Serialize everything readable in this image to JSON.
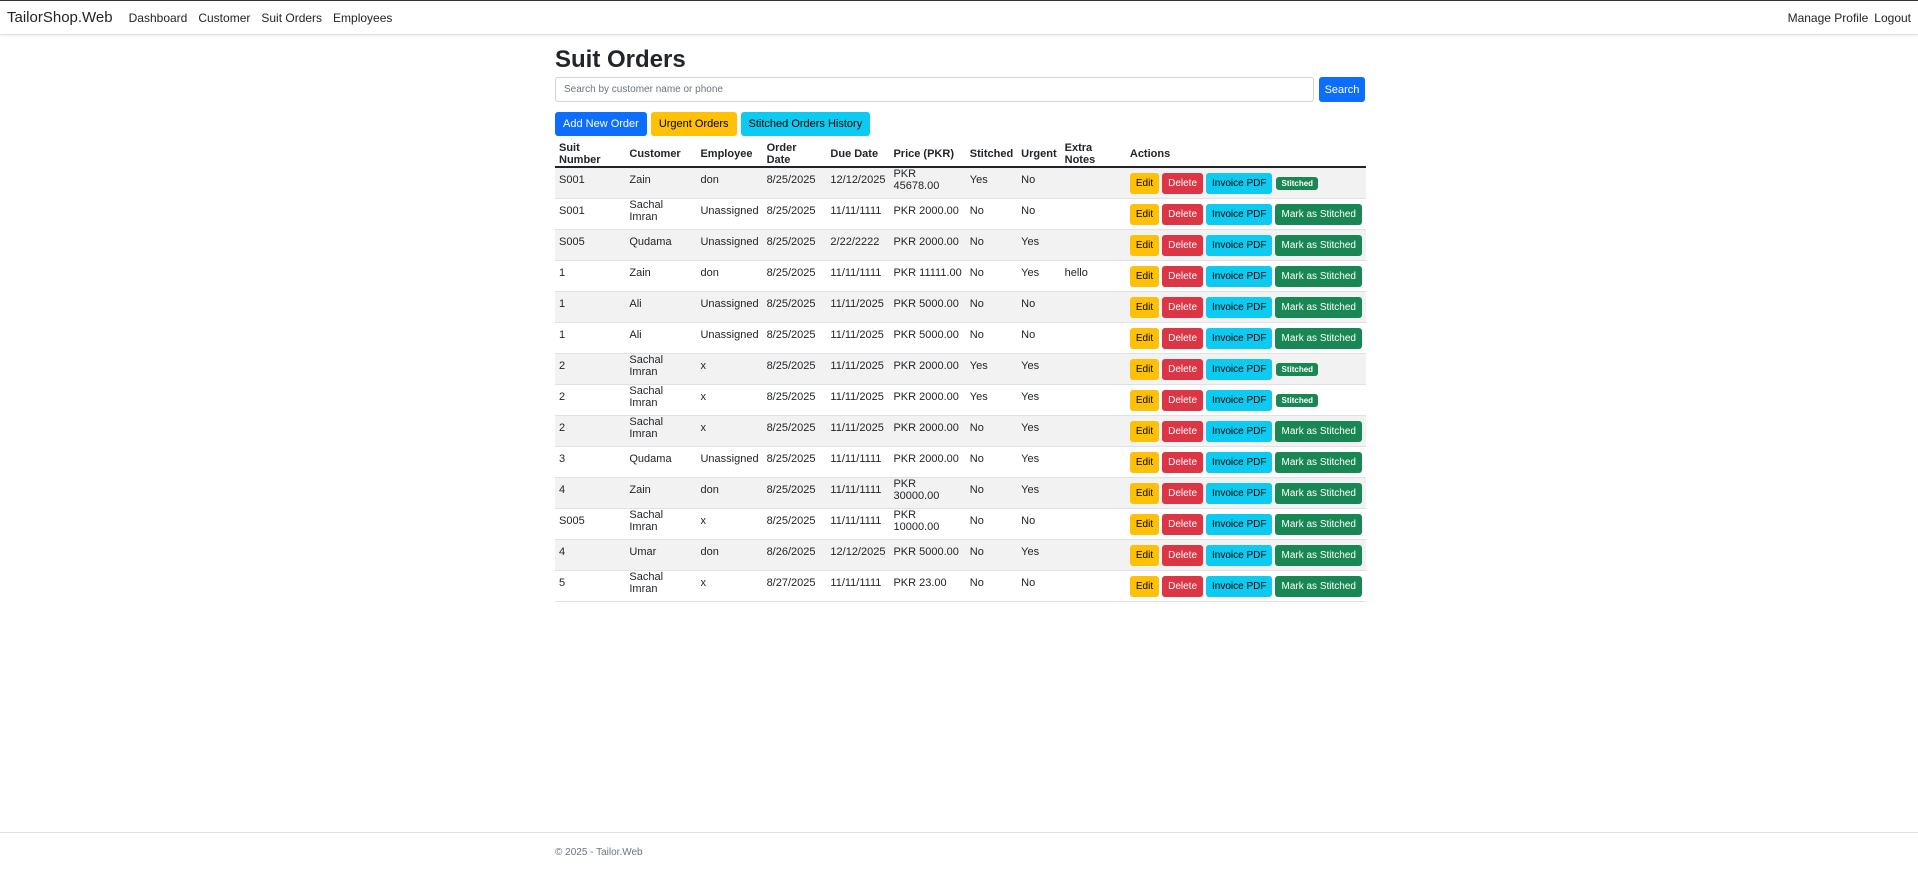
{
  "nav": {
    "brand": "TailorShop.Web",
    "links": [
      "Dashboard",
      "Customer",
      "Suit Orders",
      "Employees"
    ],
    "right": [
      "Manage Profile",
      "Logout"
    ]
  },
  "page": {
    "title": "Suit Orders"
  },
  "search": {
    "placeholder": "Search by customer name or phone",
    "value": "",
    "button": "Search"
  },
  "actions": {
    "add": "Add New Order",
    "urgent": "Urgent Orders",
    "history": "Stitched Orders History"
  },
  "table": {
    "headers": [
      "Suit Number",
      "Customer",
      "Employee",
      "Order Date",
      "Due Date",
      "Price (PKR)",
      "Stitched",
      "Urgent",
      "Extra Notes",
      "Actions"
    ],
    "rows": [
      {
        "suit": "S001",
        "customer": "Zain",
        "employee": "don",
        "order_date": "8/25/2025",
        "due_date": "12/12/2025",
        "price": "PKR 45678.00",
        "stitched": "Yes",
        "urgent": "No",
        "notes": "",
        "is_stitched": true
      },
      {
        "suit": "S001",
        "customer": "Sachal Imran",
        "employee": "Unassigned",
        "order_date": "8/25/2025",
        "due_date": "11/11/1111",
        "price": "PKR 2000.00",
        "stitched": "No",
        "urgent": "No",
        "notes": "",
        "is_stitched": false
      },
      {
        "suit": "S005",
        "customer": "Qudama",
        "employee": "Unassigned",
        "order_date": "8/25/2025",
        "due_date": "2/22/2222",
        "price": "PKR 2000.00",
        "stitched": "No",
        "urgent": "Yes",
        "notes": "",
        "is_stitched": false
      },
      {
        "suit": "1",
        "customer": "Zain",
        "employee": "don",
        "order_date": "8/25/2025",
        "due_date": "11/11/1111",
        "price": "PKR 11111.00",
        "stitched": "No",
        "urgent": "Yes",
        "notes": "hello",
        "is_stitched": false
      },
      {
        "suit": "1",
        "customer": "Ali",
        "employee": "Unassigned",
        "order_date": "8/25/2025",
        "due_date": "11/11/2025",
        "price": "PKR 5000.00",
        "stitched": "No",
        "urgent": "No",
        "notes": "",
        "is_stitched": false
      },
      {
        "suit": "1",
        "customer": "Ali",
        "employee": "Unassigned",
        "order_date": "8/25/2025",
        "due_date": "11/11/2025",
        "price": "PKR 5000.00",
        "stitched": "No",
        "urgent": "No",
        "notes": "",
        "is_stitched": false
      },
      {
        "suit": "2",
        "customer": "Sachal Imran",
        "employee": "x",
        "order_date": "8/25/2025",
        "due_date": "11/11/2025",
        "price": "PKR 2000.00",
        "stitched": "Yes",
        "urgent": "Yes",
        "notes": "",
        "is_stitched": true
      },
      {
        "suit": "2",
        "customer": "Sachal Imran",
        "employee": "x",
        "order_date": "8/25/2025",
        "due_date": "11/11/2025",
        "price": "PKR 2000.00",
        "stitched": "Yes",
        "urgent": "Yes",
        "notes": "",
        "is_stitched": true
      },
      {
        "suit": "2",
        "customer": "Sachal Imran",
        "employee": "x",
        "order_date": "8/25/2025",
        "due_date": "11/11/2025",
        "price": "PKR 2000.00",
        "stitched": "No",
        "urgent": "Yes",
        "notes": "",
        "is_stitched": false
      },
      {
        "suit": "3",
        "customer": "Qudama",
        "employee": "Unassigned",
        "order_date": "8/25/2025",
        "due_date": "11/11/1111",
        "price": "PKR 2000.00",
        "stitched": "No",
        "urgent": "Yes",
        "notes": "",
        "is_stitched": false
      },
      {
        "suit": "4",
        "customer": "Zain",
        "employee": "don",
        "order_date": "8/25/2025",
        "due_date": "11/11/1111",
        "price": "PKR 30000.00",
        "stitched": "No",
        "urgent": "Yes",
        "notes": "",
        "is_stitched": false
      },
      {
        "suit": "S005",
        "customer": "Sachal Imran",
        "employee": "x",
        "order_date": "8/25/2025",
        "due_date": "11/11/1111",
        "price": "PKR 10000.00",
        "stitched": "No",
        "urgent": "No",
        "notes": "",
        "is_stitched": false
      },
      {
        "suit": "4",
        "customer": "Umar",
        "employee": "don",
        "order_date": "8/26/2025",
        "due_date": "12/12/2025",
        "price": "PKR 5000.00",
        "stitched": "No",
        "urgent": "Yes",
        "notes": "",
        "is_stitched": false
      },
      {
        "suit": "5",
        "customer": "Sachal Imran",
        "employee": "x",
        "order_date": "8/27/2025",
        "due_date": "11/11/1111",
        "price": "PKR 23.00",
        "stitched": "No",
        "urgent": "No",
        "notes": "",
        "is_stitched": false
      }
    ],
    "row_actions": {
      "edit": "Edit",
      "delete": "Delete",
      "invoice": "Invoice PDF",
      "mark": "Mark as Stitched",
      "badge": "Stitched"
    }
  },
  "colors": {
    "primary": "#0d6efd",
    "warning": "#ffc107",
    "danger": "#dc3545",
    "info": "#0dcaf0",
    "success": "#198754"
  },
  "footer": {
    "text": "© 2025 - Tailor.Web"
  }
}
